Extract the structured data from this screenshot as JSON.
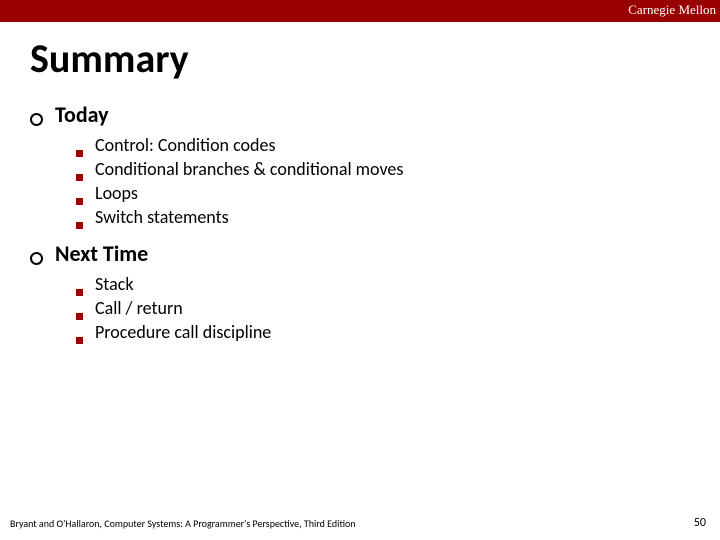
{
  "header": {
    "org": "Carnegie Mellon"
  },
  "title": "Summary",
  "sections": [
    {
      "heading": "Today",
      "items": [
        "Control: Condition codes",
        "Conditional branches & conditional moves",
        "Loops",
        "Switch statements"
      ]
    },
    {
      "heading": "Next Time",
      "items": [
        "Stack",
        "Call / return",
        "Procedure call discipline"
      ]
    }
  ],
  "footer": {
    "left": "Bryant and O'Hallaron, Computer Systems: A Programmer's Perspective, Third Edition",
    "page": "50"
  }
}
